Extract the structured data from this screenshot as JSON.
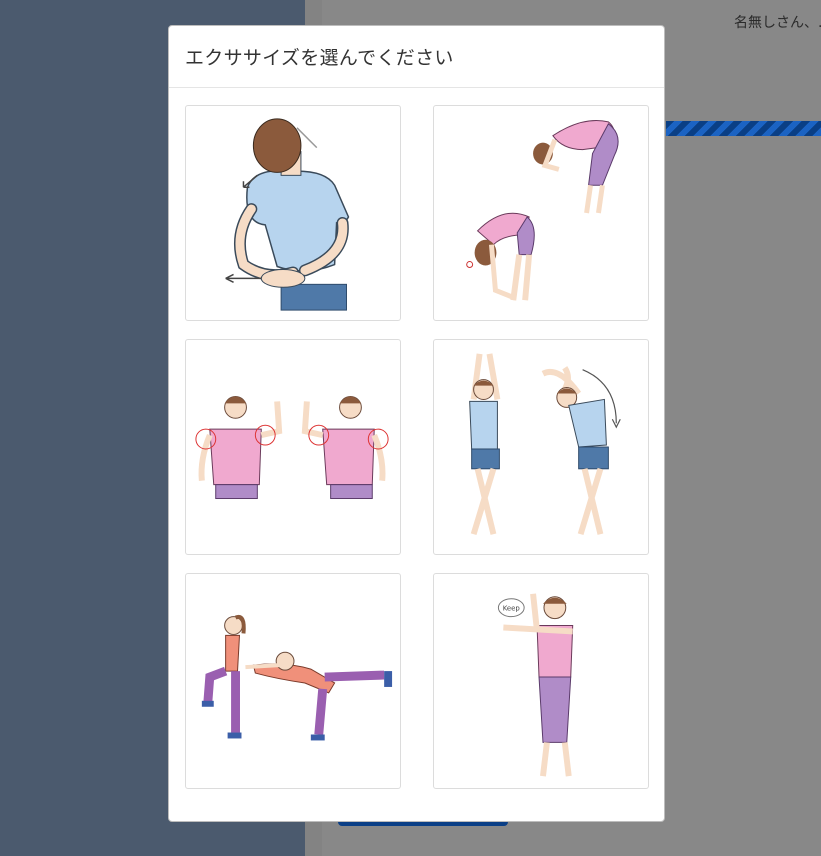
{
  "background": {
    "user_greeting": "名無しさん、."
  },
  "modal": {
    "title": "エクササイズを選んでください",
    "exercises": [
      {
        "illustration": "shoulder-stretch-behind-back"
      },
      {
        "illustration": "forward-bend-stretch"
      },
      {
        "illustration": "arm-circle-rotation"
      },
      {
        "illustration": "overhead-side-stretch"
      },
      {
        "illustration": "knee-raise-balance"
      },
      {
        "illustration": "cross-body-arm-stretch"
      }
    ],
    "keep_label": "Keep"
  },
  "colors": {
    "sidebar": "#4b5a6e",
    "overlay_main": "#888888",
    "accent_blue": "#0b3f86",
    "shirt_blue": "#b7d4ee",
    "shirt_pink": "#f0a9cf",
    "pants_purple": "#b08cc8",
    "skin": "#f6dcc6",
    "hair": "#8b5a3c"
  }
}
